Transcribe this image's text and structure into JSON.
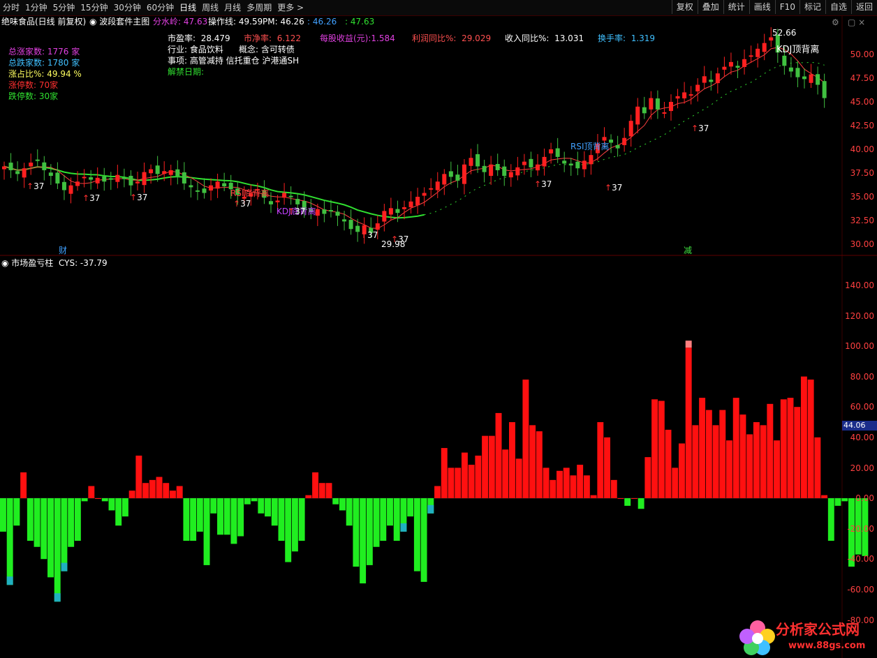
{
  "toolbar": {
    "periods": [
      "分时",
      "1分钟",
      "5分钟",
      "15分钟",
      "30分钟",
      "60分钟",
      "日线",
      "周线",
      "月线",
      "多周期",
      "更多 >"
    ],
    "active_period": "日线",
    "right_buttons": [
      "复权",
      "叠加",
      "统计",
      "画线",
      "F10",
      "标记",
      "自选",
      "返回"
    ]
  },
  "main_header": {
    "stock": "绝味食品(日线 前复权)",
    "indicator": "波段套件主图",
    "fenshui_label": "分水岭:",
    "fenshui_value": "47.63",
    "caozuo": "操作线: 49.59",
    "pm": "PM: 46.26",
    "v1": ": 46.26",
    "v2": ": 47.63"
  },
  "stats": [
    {
      "text": "总涨家数: 1776 家",
      "color": "#e040e0"
    },
    {
      "text": "总跌家数: 1780 家",
      "color": "#40c0ff"
    },
    {
      "text": "涨占比%: 49.94 %",
      "color": "#ffff60"
    },
    {
      "text": "涨停数: 70家",
      "color": "#ff3030"
    },
    {
      "text": "跌停数: 30家",
      "color": "#30e030"
    }
  ],
  "fundamentals": {
    "pe_label": "市盈率:",
    "pe": "28.479",
    "pb_label": "市净率:",
    "pb": "6.122",
    "eps_label": "每股收益(元):",
    "eps": "1.584",
    "profit_label": "利润同比%:",
    "profit": "29.029",
    "rev_label": "收入同比%:",
    "rev": "13.031",
    "turnover_label": "换手率:",
    "turnover": "1.319",
    "industry": "行业: 食品饮料",
    "concept_label": "概念:",
    "concept": "含可转债",
    "events": "事项: 高管减持 信托重仓 沪港通SH",
    "unlock": "解禁日期:"
  },
  "price_axis": [
    "50.00",
    "47.50",
    "45.00",
    "42.50",
    "40.00",
    "37.50",
    "35.00",
    "32.50",
    "30.00"
  ],
  "annotations": {
    "high": "52.66",
    "low": "29.98",
    "kdj_top": "KDJ顶背离",
    "rsi_top": "RSI顶背离",
    "rsi_bottom": "RSI底背离",
    "kdj_bottom": "KDJ底背离",
    "cai": "财",
    "jian": "减",
    "tag": "37"
  },
  "sub_header": {
    "name": "市场盈亏柱",
    "cys": "CYS: -37.79"
  },
  "sub_axis": [
    "140.00",
    "120.00",
    "100.00",
    "80.00",
    "60.00",
    "40.00",
    "20.00",
    "0.00",
    "-20.00",
    "-40.00",
    "-60.00",
    "-80.00"
  ],
  "sub_tag": "44.06",
  "watermark": {
    "title": "分析家公式网",
    "url": "www.88gs.com"
  },
  "colors": {
    "up": "#ff2020",
    "down": "#20e020",
    "ma": "#30e030",
    "grid": "#3a0000"
  },
  "chart_data": {
    "type": "bar",
    "title": "市场盈亏柱",
    "ylim": [
      -80,
      150
    ],
    "values": [
      -22,
      -57,
      -18,
      17,
      -28,
      -32,
      -40,
      -52,
      -68,
      -48,
      -32,
      -28,
      -2,
      8,
      0,
      -2,
      -8,
      -18,
      -12,
      5,
      28,
      10,
      12,
      14,
      10,
      5,
      8,
      -28,
      -28,
      -22,
      -44,
      -10,
      -24,
      -24,
      -30,
      -25,
      -4,
      -2,
      -10,
      -12,
      -18,
      -28,
      -42,
      -35,
      -28,
      2,
      17,
      10,
      10,
      -4,
      -8,
      -18,
      -45,
      -56,
      -44,
      -32,
      -28,
      -18,
      -28,
      -22,
      -12,
      -48,
      -55,
      -10,
      8,
      33,
      20,
      20,
      30,
      22,
      28,
      41,
      41,
      56,
      32,
      50,
      26,
      78,
      48,
      44,
      20,
      12,
      18,
      20,
      15,
      22,
      15,
      2,
      50,
      40,
      12,
      0,
      -5,
      0,
      -7,
      27,
      65,
      64,
      45,
      20,
      36,
      99,
      48,
      66,
      58,
      48,
      58,
      38,
      66,
      55,
      42,
      50,
      48,
      62,
      38,
      65,
      66,
      60,
      80,
      78,
      40,
      2,
      -28,
      -5,
      -2,
      -45,
      -37,
      -38
    ],
    "cyan_tips": [
      1,
      8,
      9,
      59,
      63
    ]
  }
}
